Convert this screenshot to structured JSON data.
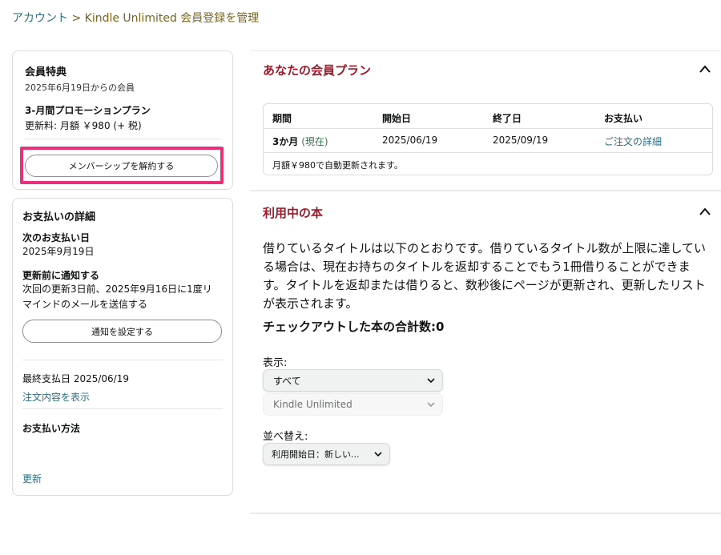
{
  "breadcrumb": {
    "account": "アカウント",
    "separator": " > ",
    "current": "Kindle Unlimited 会員登録を管理"
  },
  "membership_card": {
    "title": "会員特典",
    "member_since": "2025年6月19日からの会員",
    "plan_name": "3-月間プロモーションプラン",
    "renewal_fee": "更新料: 月額 ￥980 (+ 税)",
    "cancel_button": "メンバーシップを解約する"
  },
  "payment_card": {
    "title": "お支払いの詳細",
    "next_payment_label": "次のお支払い日",
    "next_payment_date": "2025年9月19日",
    "notify_label": "更新前に通知する",
    "notify_desc_1": "次回の更新3日前、2025年9月16日に1度リ",
    "notify_desc_2": "マインドのメールを送信する",
    "notify_button": "通知を設定する",
    "last_payment": "最終支払日 2025/06/19",
    "view_order_link": "注文内容を表示",
    "payment_method_label": "お支払い方法",
    "update_link": "更新"
  },
  "plan_section": {
    "title": "あなたの会員プラン",
    "columns": [
      "期間",
      "開始日",
      "終了日",
      "お支払い"
    ],
    "row": {
      "period": "3か月",
      "current": "(現在)",
      "start": "2025/06/19",
      "end": "2025/09/19",
      "payment_link": "ご注文の詳細"
    },
    "auto_renew_note": "月額￥980で自動更新されます。"
  },
  "books_section": {
    "title": "利用中の本",
    "description": "借りているタイトルは以下のとおりです。借りているタイトル数が上限に達している場合は、現在お持ちのタイトルを返却することでもう1冊借りることができます。タイトルを返却または借りると、数秒後にページが更新され、更新したリストが表示されます。",
    "checkout_total": "チェックアウトした本の合計数:0",
    "display_label": "表示:",
    "display_select_value": "すべて",
    "program_select_value": "Kindle Unlimited",
    "sort_label": "並べ替え:",
    "sort_select_value": "利用開始日：新しい..."
  },
  "colors": {
    "section_heading": "#a0192b",
    "link": "#2a6f7f",
    "highlight_frame": "#e8317a",
    "current_badge": "#2e7d4f"
  },
  "icons": {
    "collapse": "chevron-up-icon",
    "dropdown": "chevron-down-icon"
  }
}
